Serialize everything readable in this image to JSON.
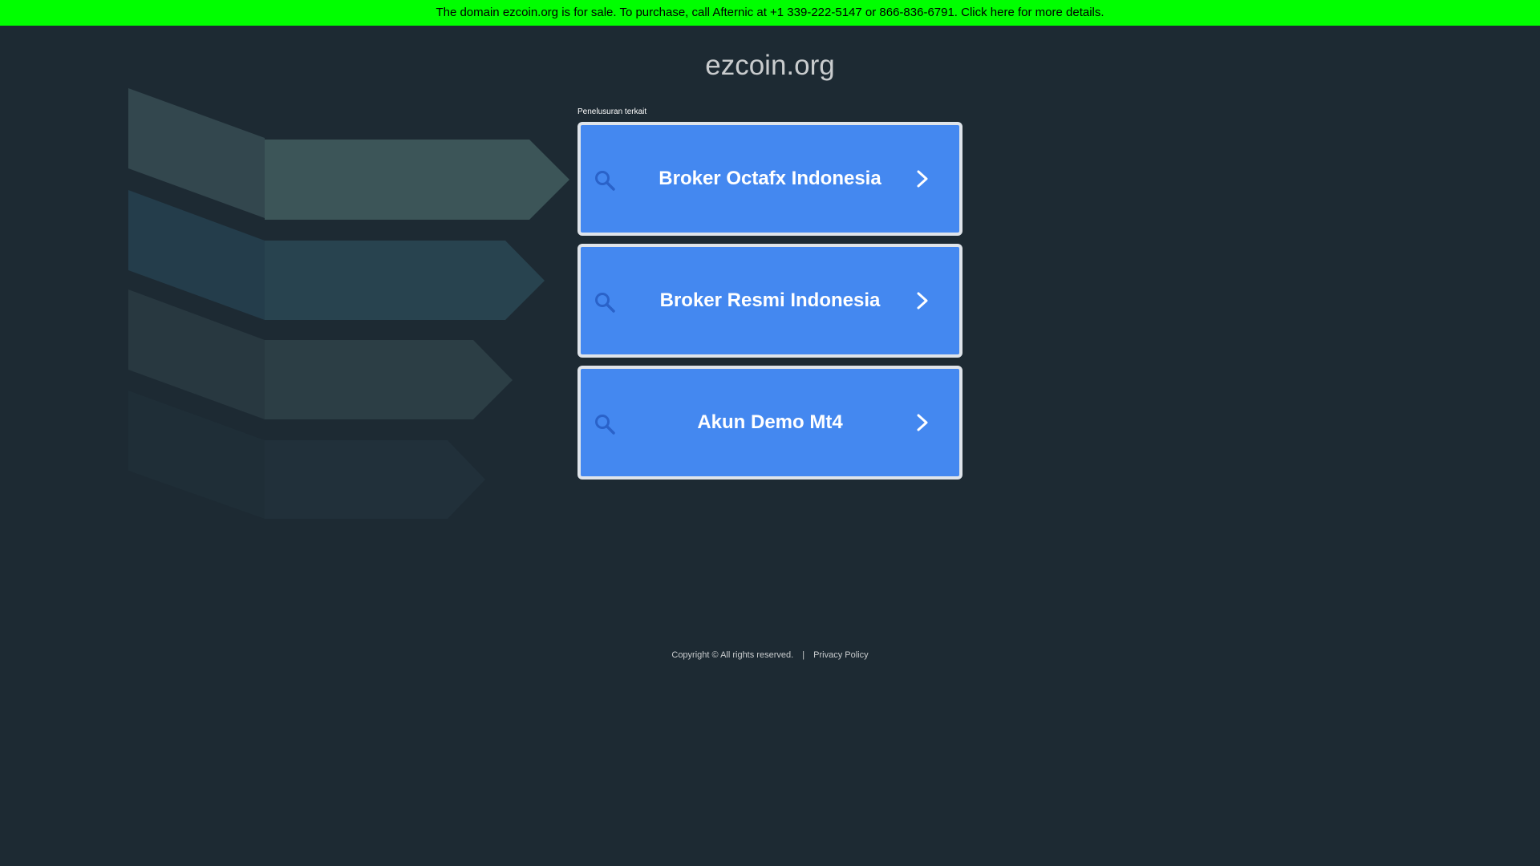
{
  "banner": {
    "text": "The domain ezcoin.org is for sale. To purchase, call Afternic at +1 339-222-5147 or 866-836-6791. Click here for more details.",
    "background_color": "#00ff00"
  },
  "site": {
    "title": "ezcoin.org"
  },
  "related": {
    "label": "Penelusuran terkait",
    "items": [
      {
        "label": "Broker Octafx Indonesia",
        "icon": "search-icon",
        "action_icon": "chevron-right-icon"
      },
      {
        "label": "Broker Resmi Indonesia",
        "icon": "search-icon",
        "action_icon": "chevron-right-icon"
      },
      {
        "label": "Akun Demo Mt4",
        "icon": "search-icon",
        "action_icon": "chevron-right-icon"
      }
    ],
    "button_color": "#4488f0"
  },
  "footer": {
    "copyright": "Copyright © All rights reserved.",
    "separator": "|",
    "privacy_label": "Privacy Policy"
  },
  "colors": {
    "page_background": "#1d2a33",
    "decor_row_1": "#3b5457",
    "decor_row_2": "#27434f",
    "decor_row_3": "#2c3d44",
    "decor_row_4": "#21303a"
  }
}
